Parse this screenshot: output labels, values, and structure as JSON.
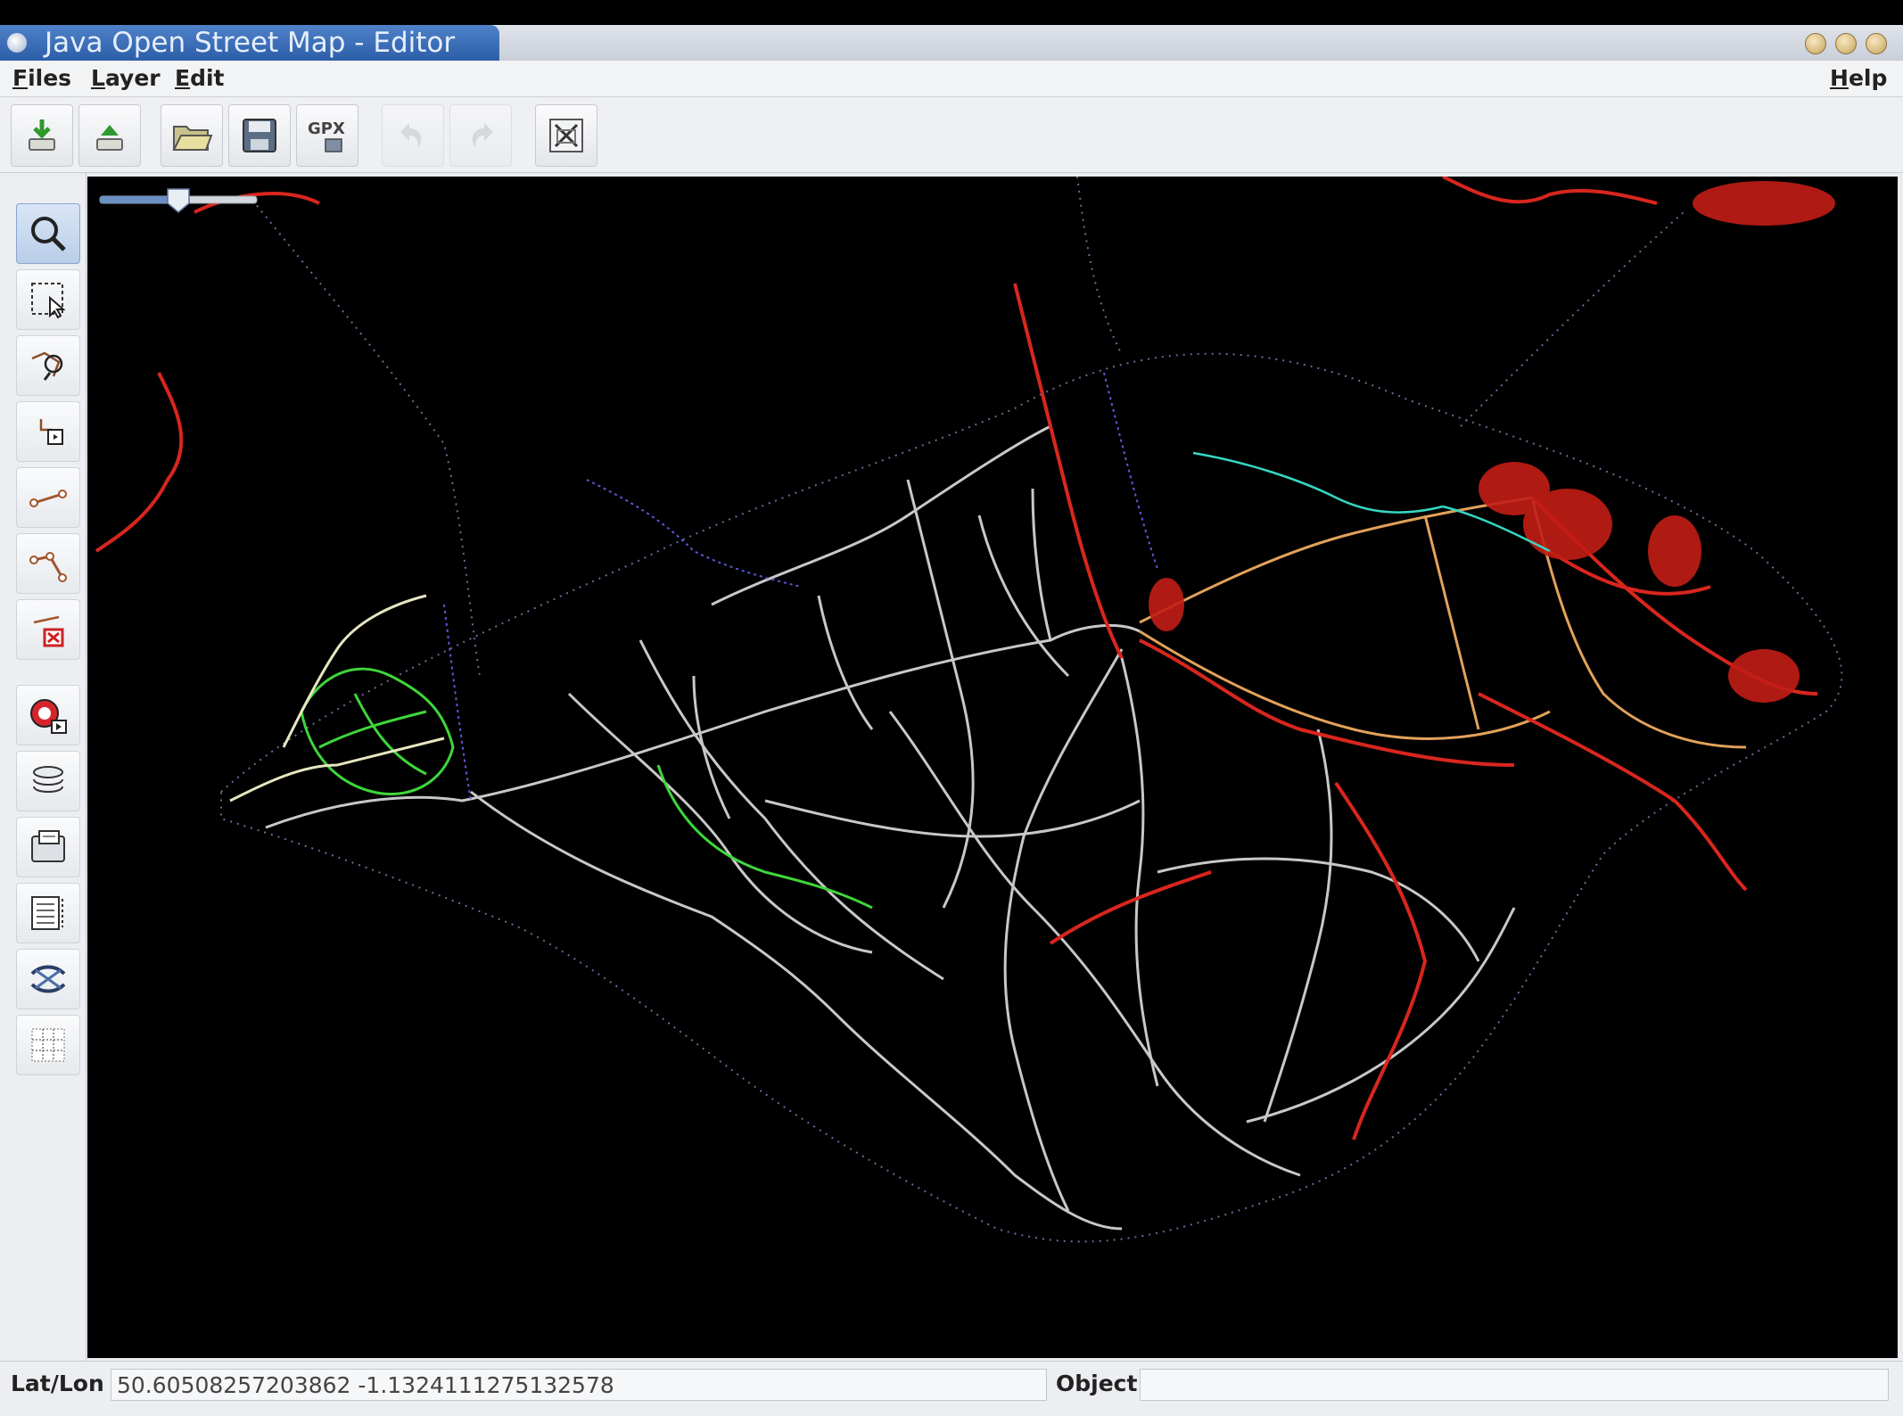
{
  "window": {
    "title": "Java Open Street Map - Editor"
  },
  "menubar": {
    "files": "Files",
    "layer": "Layer",
    "edit": "Edit",
    "help": "Help"
  },
  "toolbar": {
    "buttons": [
      {
        "name": "download",
        "icon": "download-icon"
      },
      {
        "name": "upload",
        "icon": "upload-icon"
      },
      {
        "name": "open",
        "icon": "folder-open-icon"
      },
      {
        "name": "save",
        "icon": "save-icon"
      },
      {
        "name": "export-gpx",
        "icon": "gpx-icon",
        "label": "GPX"
      },
      {
        "name": "undo",
        "icon": "undo-icon",
        "enabled": false
      },
      {
        "name": "redo",
        "icon": "redo-icon",
        "enabled": false
      },
      {
        "name": "exit",
        "icon": "exit-icon"
      }
    ]
  },
  "sidebar": {
    "tools": [
      {
        "name": "zoom",
        "icon": "magnifier-icon",
        "active": true
      },
      {
        "name": "select",
        "icon": "select-icon"
      },
      {
        "name": "move",
        "icon": "move-icon"
      },
      {
        "name": "add-node",
        "icon": "add-node-icon"
      },
      {
        "name": "add-line",
        "icon": "add-line-icon"
      },
      {
        "name": "add-way",
        "icon": "add-way-icon"
      },
      {
        "name": "delete",
        "icon": "delete-icon"
      },
      {
        "name": "autoscale",
        "icon": "autoscale-icon"
      },
      {
        "name": "layers",
        "icon": "layers-icon"
      },
      {
        "name": "properties",
        "icon": "properties-icon"
      },
      {
        "name": "list",
        "icon": "list-icon"
      },
      {
        "name": "conflicts",
        "icon": "conflict-icon"
      },
      {
        "name": "grid",
        "icon": "grid-icon"
      }
    ]
  },
  "map": {
    "zoom_level": 0.5,
    "background": "#000000",
    "colors": {
      "roads": "#c8c8c8",
      "primary": "#d8261e",
      "secondary": "#e2a25a",
      "tracks": "#5a5ad8",
      "green": "#3ed63a",
      "cyan": "#36d7c3",
      "cream": "#e8e6c0"
    }
  },
  "status": {
    "latlon_label": "Lat/Lon",
    "latlon_value": "50.60508257203862 -1.1324111275132578",
    "object_label": "Object",
    "object_value": ""
  }
}
